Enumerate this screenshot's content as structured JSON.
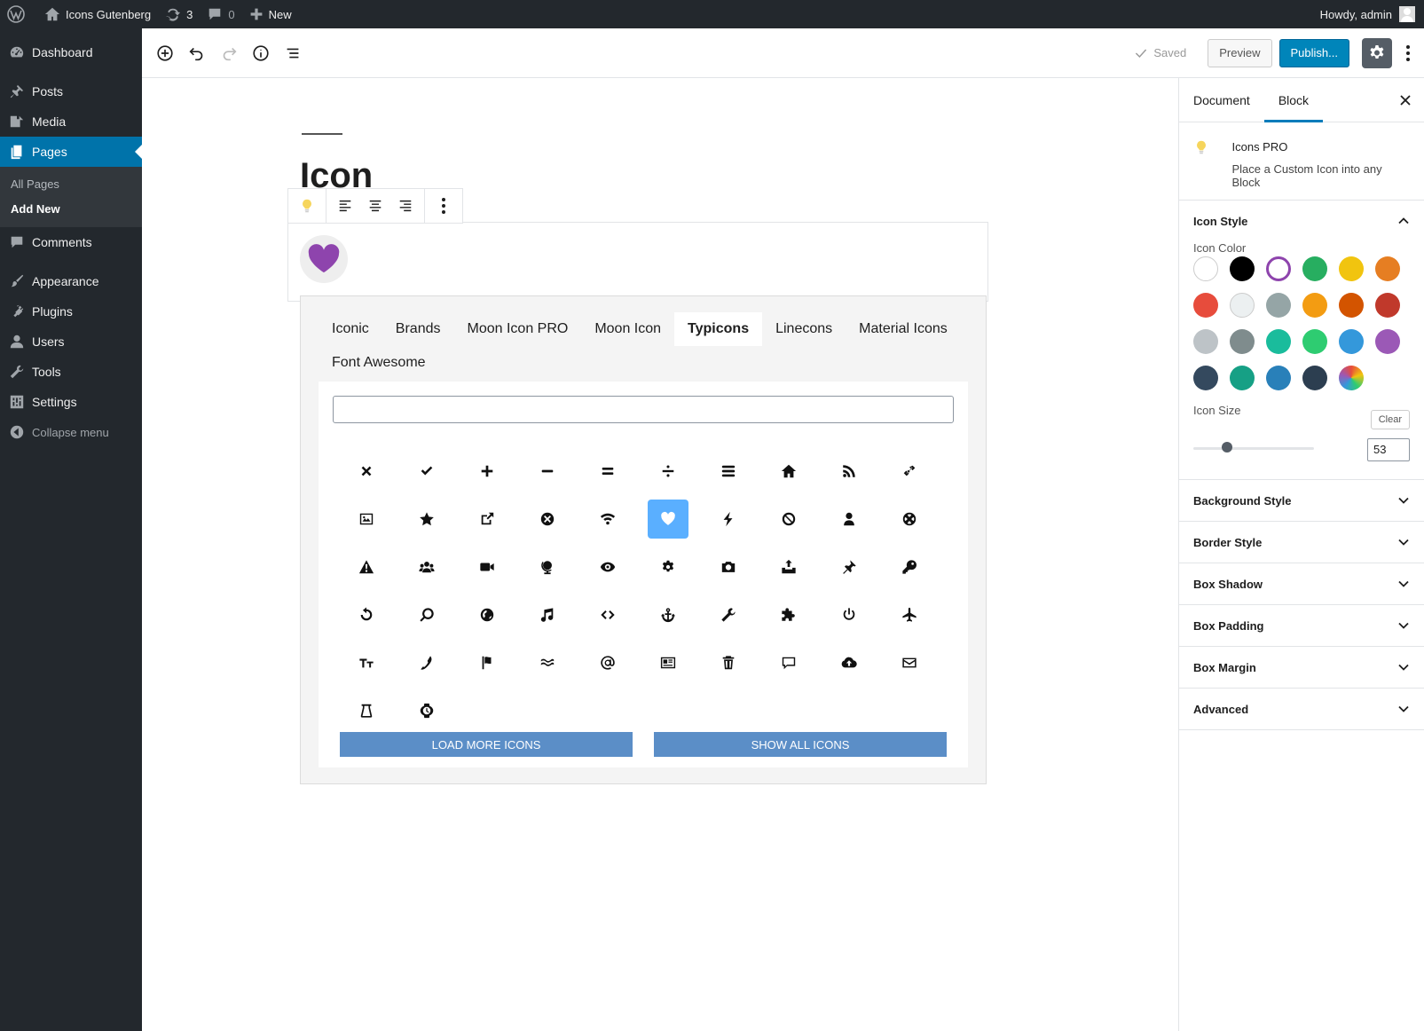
{
  "adminbar": {
    "site_name": "Icons Gutenberg",
    "updates_count": "3",
    "comments_count": "0",
    "new_label": "New",
    "howdy": "Howdy, admin"
  },
  "menu": {
    "items": [
      {
        "label": "Dashboard",
        "icon": "dashboard-icon"
      },
      {
        "label": "Posts",
        "icon": "pin-icon"
      },
      {
        "label": "Media",
        "icon": "media-icon"
      },
      {
        "label": "Pages",
        "icon": "pages-icon"
      },
      {
        "label": "Comments",
        "icon": "comment-icon"
      },
      {
        "label": "Appearance",
        "icon": "brush-icon"
      },
      {
        "label": "Plugins",
        "icon": "plugin-icon"
      },
      {
        "label": "Users",
        "icon": "user-icon"
      },
      {
        "label": "Tools",
        "icon": "wrench-icon"
      },
      {
        "label": "Settings",
        "icon": "settings-icon"
      }
    ],
    "submenu": [
      "All Pages",
      "Add New"
    ],
    "collapse": "Collapse menu"
  },
  "header": {
    "saved": "Saved",
    "preview": "Preview",
    "publish": "Publish..."
  },
  "editor": {
    "title": "Icon"
  },
  "picker": {
    "tabs": [
      "Iconic",
      "Brands",
      "Moon Icon PRO",
      "Moon Icon",
      "Typicons",
      "Linecons",
      "Material Icons",
      "Font Awesome"
    ],
    "active_tab": "Typicons",
    "search_value": "",
    "load_more": "LOAD MORE ICONS",
    "show_all": "SHOW ALL ICONS",
    "selected_icon": "heart-icon",
    "icons": [
      "times-icon",
      "tick-icon",
      "plus-icon",
      "minus-icon",
      "equals-icon",
      "divide-icon",
      "menu-icon",
      "home-icon",
      "rss-icon",
      "link-icon",
      "image-icon",
      "star-icon",
      "export-icon",
      "delete-icon",
      "wifi-icon",
      "heart-icon",
      "flash-icon",
      "cancel-icon",
      "user-icon",
      "support-icon",
      "warning-icon",
      "group-icon",
      "video-icon",
      "globe-icon",
      "eye-icon",
      "cog-icon",
      "camera-icon",
      "upload-icon",
      "pin-icon",
      "key-icon",
      "refresh-icon",
      "zoom-icon",
      "world-icon",
      "music-icon",
      "code-icon",
      "anchor-icon",
      "spanner-icon",
      "puzzle-icon",
      "power-icon",
      "plane-icon",
      "font-size-icon",
      "phone-icon",
      "flag-icon",
      "waves-icon",
      "at-icon",
      "news-icon",
      "trash-icon",
      "message-icon",
      "cloud-upload-icon",
      "mail-icon",
      "beaker-icon",
      "watch-icon"
    ]
  },
  "sidebar": {
    "tabs": [
      "Document",
      "Block"
    ],
    "active_tab": "Block",
    "block_title": "Icons PRO",
    "block_desc": "Place a Custom Icon into any Block",
    "icon_style": {
      "title": "Icon Style",
      "color_label": "Icon Color",
      "colors": [
        "#ffffff",
        "#000000",
        "#ffffff",
        "#27ae60",
        "#f1c40f",
        "#e67e22",
        "#e74c3c",
        "#ecf0f1",
        "#95a5a6",
        "#f39c12",
        "#d35400",
        "#c0392b",
        "#bdc3c7",
        "#7f8c8d",
        "#1abc9c",
        "#2ecc71",
        "#3498db",
        "#9b59b6",
        "#34495e",
        "#16a085",
        "#2980b9",
        "#2c3e50",
        "gradient"
      ],
      "selected_color_index": 2,
      "selected_color": "#8e44ad",
      "size_label": "Icon Size",
      "clear": "Clear",
      "size_value": "53",
      "size_fraction": 0.28
    },
    "panels": [
      "Background Style",
      "Border Style",
      "Box Shadow",
      "Box Padding",
      "Box Margin",
      "Advanced"
    ]
  }
}
